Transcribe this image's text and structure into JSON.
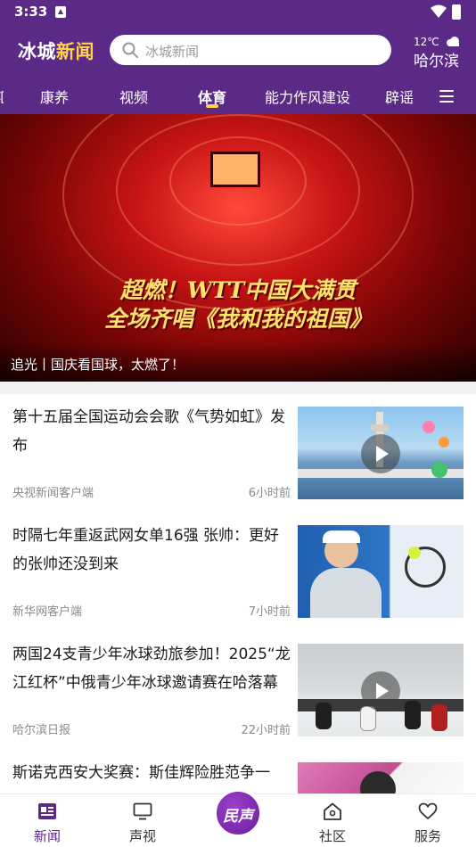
{
  "status_bar": {
    "time": "3:33"
  },
  "header": {
    "brand_prefix": "冰城",
    "brand_highlight": "新闻",
    "search_placeholder": "冰城新闻",
    "weather_temp": "12℃",
    "weather_city": "哈尔滨"
  },
  "tabs": {
    "partial": "汇",
    "items": [
      "康养",
      "视频",
      "体育",
      "能力作风建设",
      "辟谣"
    ],
    "active": "体育"
  },
  "banner": {
    "headline_line1": "超燃！WTT中国大满贯",
    "headline_line2": "全场齐唱《我和我的祖国》",
    "caption": "追光丨国庆看国球，太燃了！"
  },
  "news": [
    {
      "title": "第十五届全国运动会会歌《气势如虹》发布",
      "source": "央视新闻客户端",
      "time": "6小时前",
      "video": true
    },
    {
      "title": "时隔七年重返武网女单16强 张帅：更好的张帅还没到来",
      "source": "新华网客户端",
      "time": "7小时前",
      "video": false
    },
    {
      "title": "两国24支青少年冰球劲旅参加！2025“龙江红杯”中俄青少年冰球邀请赛在哈落幕",
      "source": "哈尔滨日报",
      "time": "22小时前",
      "video": true
    },
    {
      "title": "斯诺克西安大奖赛：斯佳辉险胜范争一",
      "source": "",
      "time": "",
      "video": false
    }
  ],
  "bottom_nav": {
    "items": [
      "新闻",
      "声视",
      "社区",
      "服务"
    ],
    "center_label": "民声",
    "active": "新闻"
  },
  "colors": {
    "brand_purple": "#5b2a86",
    "accent_yellow": "#ffd24a"
  }
}
